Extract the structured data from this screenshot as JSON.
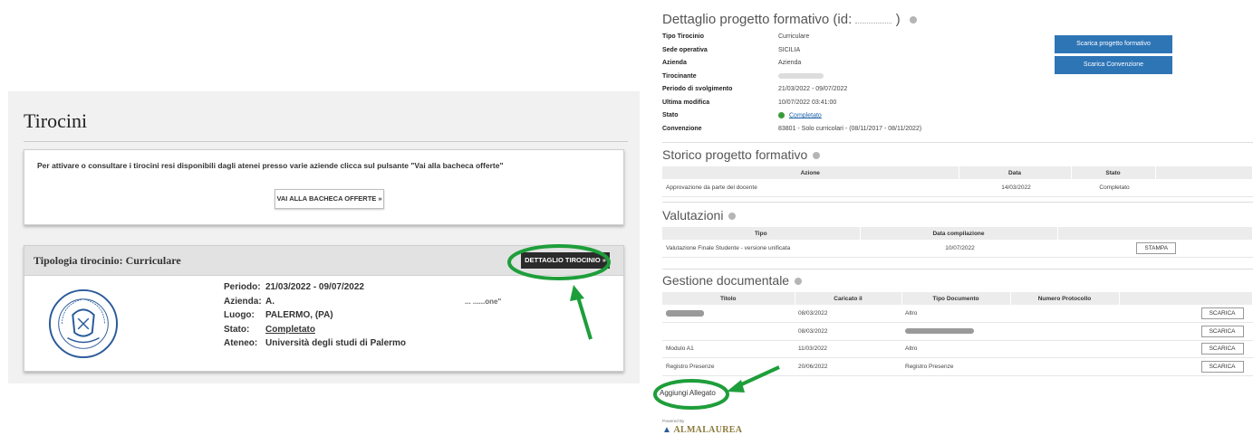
{
  "left": {
    "title": "Tirocini",
    "notice": "Per attivare o consultare i tirocini resi disponibili dagli atenei presso varie aziende clicca sul pulsante \"Vai alla bacheca offerte\"",
    "bacheca_button": "VAI ALLA BACHECA OFFERTE »",
    "card_title": "Tipologia tirocinio: Curriculare",
    "detail_button": "DETTAGLIO TIROCINIO »",
    "info": [
      {
        "label": "Periodo:",
        "value": "21/03/2022 - 09/07/2022"
      },
      {
        "label": "Azienda:",
        "value": "A."
      },
      {
        "label": "Luogo:",
        "value": "PALERMO, (PA)"
      },
      {
        "label": "Stato:",
        "value": "Completato"
      },
      {
        "label": "Ateneo:",
        "value": "Università degli studi di Palermo"
      }
    ],
    "blurred_text": "... ......one\""
  },
  "right": {
    "detail_title": "Dettaglio progetto formativo (id:",
    "detail_title_close": ")",
    "details": [
      {
        "label": "Tipo Tirocinio",
        "value": "Curriculare"
      },
      {
        "label": "Sede operativa",
        "value": "SICILIA"
      },
      {
        "label": "Azienda",
        "value": "Azienda"
      },
      {
        "label": "Tirocinante",
        "value": ""
      },
      {
        "label": "Periodo di svolgimento",
        "value": "21/03/2022 - 09/07/2022"
      },
      {
        "label": "Ultima modifica",
        "value": "10/07/2022 03:41:00"
      },
      {
        "label": "Stato",
        "value": "Completato"
      },
      {
        "label": "Convenzione",
        "value": "83801 - Solo curricolari - (08/11/2017 - 08/11/2022)"
      }
    ],
    "btn_progetto": "Scarica progetto formativo",
    "btn_convenzione": "Scarica Convenzione",
    "storico": {
      "title": "Storico progetto formativo",
      "headers": [
        "Azione",
        "Data",
        "Stato"
      ],
      "rows": [
        [
          "Approvazione da parte del docente",
          "14/03/2022",
          "Completato"
        ]
      ]
    },
    "valutazioni": {
      "title": "Valutazioni",
      "headers": [
        "Tipo",
        "Data compilazione"
      ],
      "rows": [
        [
          "Valutazione Finale Studente - versione unificata",
          "10/07/2022"
        ]
      ],
      "button": "STAMPA"
    },
    "documenti": {
      "title": "Gestione documentale",
      "headers": [
        "Titolo",
        "Caricato il",
        "Tipo Documento",
        "Numero Protocollo"
      ],
      "rows": [
        [
          "",
          "08/03/2022",
          "Altro",
          ""
        ],
        [
          "",
          "08/03/2022",
          "",
          ""
        ],
        [
          "Modulo A1",
          "11/03/2022",
          "Altro",
          ""
        ],
        [
          "Registro Presenze",
          "20/06/2022",
          "Registro Presenze",
          ""
        ]
      ],
      "button": "SCARICA"
    },
    "aggiungi": "Aggiungi Allegato",
    "powered_by": "Powered By",
    "logo_text": "ALMALAUREA"
  },
  "colors": {
    "highlight": "#1e9e3a",
    "primary_button": "#2e75b6",
    "dark_button": "#2b2b2b",
    "status_green": "#3a9a3a"
  }
}
